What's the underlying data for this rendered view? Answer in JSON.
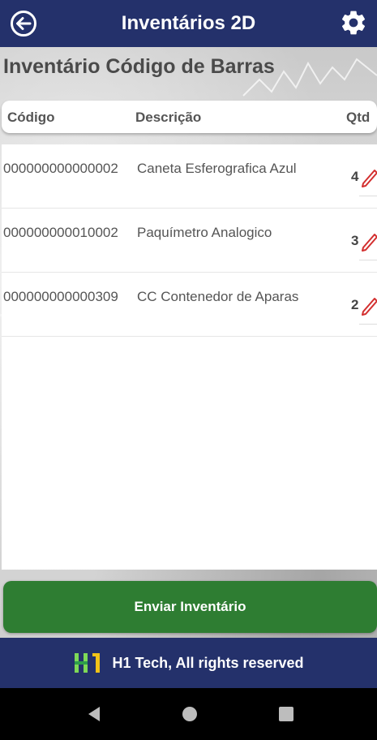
{
  "header": {
    "title": "Inventários 2D",
    "back_icon": "arrow-left-circle-icon",
    "settings_icon": "gear-icon"
  },
  "page_title": "Inventário Código de Barras",
  "table": {
    "columns": {
      "code": "Código",
      "description": "Descrição",
      "qty": "Qtd"
    },
    "rows": [
      {
        "code": "000000000000002",
        "description": "Caneta Esferografica Azul",
        "qty": "4"
      },
      {
        "code": "000000000010002",
        "description": "Paquímetro Analogico",
        "qty": "3"
      },
      {
        "code": "000000000000309",
        "description": "CC Contenedor de Aparas",
        "qty": "2"
      }
    ]
  },
  "send_button": {
    "label": "Enviar Inventário"
  },
  "footer": {
    "text": "H1 Tech, All rights reserved"
  },
  "colors": {
    "primary": "#24316b",
    "send_button": "#2e7d32",
    "edit_icon": "#d32f2f"
  }
}
